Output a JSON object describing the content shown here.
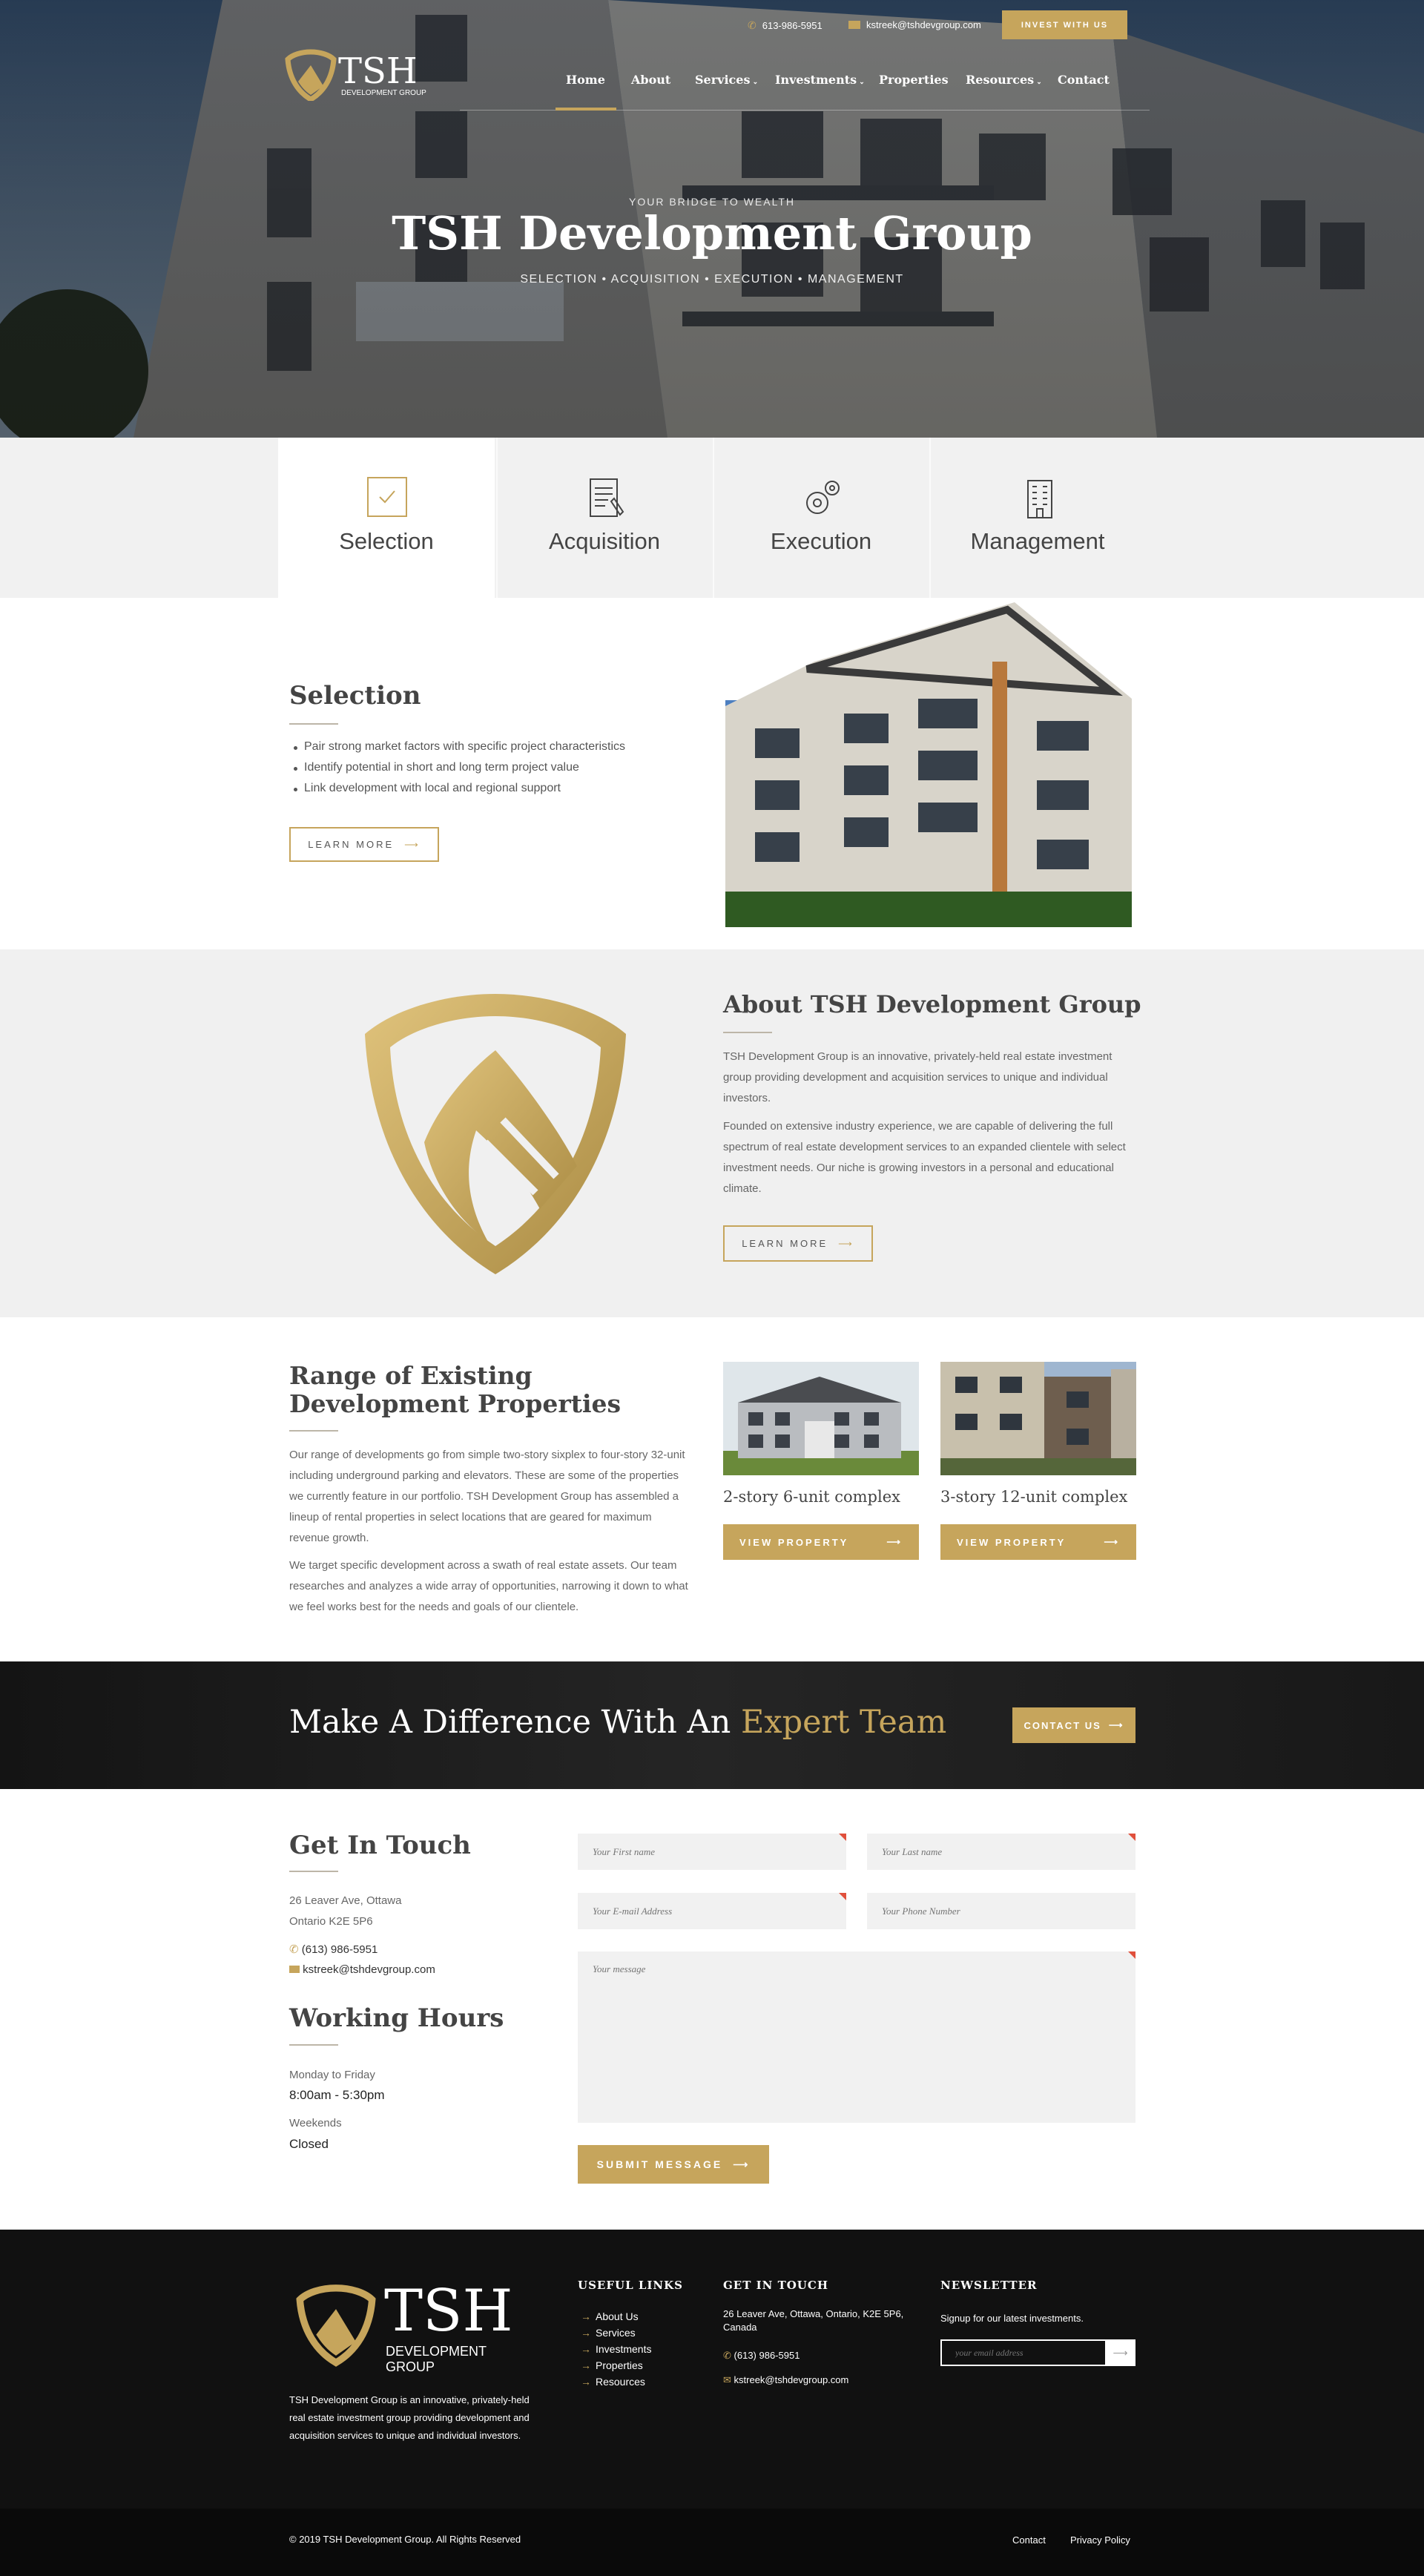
{
  "header": {
    "phone": "613-986-5951",
    "email": "kstreek@tshdevgroup.com",
    "invest_button": "INVEST WITH US",
    "logo_text": "TSH",
    "logo_sub": "DEVELOPMENT GROUP",
    "nav": [
      "Home",
      "About",
      "Services",
      "Investments",
      "Properties",
      "Resources",
      "Contact"
    ]
  },
  "hero": {
    "eyebrow": "YOUR BRIDGE TO WEALTH",
    "title": "TSH Development Group",
    "subtitle": "SELECTION • ACQUISITION • EXECUTION • MANAGEMENT"
  },
  "tabs": [
    "Selection",
    "Acquisition",
    "Execution",
    "Management"
  ],
  "selection": {
    "title": "Selection",
    "bullets": [
      "Pair strong market factors with specific project characteristics",
      "Identify potential in short and long term project value",
      "Link development with local and regional support"
    ],
    "button": "LEARN MORE"
  },
  "about": {
    "title": "About TSH Development Group",
    "p1": "TSH Development Group is an innovative, privately-held real estate investment group providing development and acquisition services to unique and individual investors.",
    "p2": "Founded on extensive industry experience, we are capable of delivering the full spectrum of real estate development services to an expanded clientele with select investment needs. Our niche is growing investors in a personal and educational climate.",
    "button": "LEARN MORE"
  },
  "range": {
    "title": "Range of Existing Development Properties",
    "p1": "Our range of developments go from simple two-story sixplex to four-story 32-unit including underground parking and elevators. These are some of the properties we currently feature in our portfolio. TSH Development Group has assembled a lineup of rental properties in select locations that are geared for maximum revenue growth.",
    "p2": "We target specific development across a swath of real estate assets. Our team researches and analyzes a wide array of opportunities, narrowing it down to what we feel works best for the needs and goals of our clientele.",
    "properties": [
      {
        "name": "2-story 6-unit complex",
        "button": "VIEW PROPERTY"
      },
      {
        "name": "3-story 12-unit complex",
        "button": "VIEW PROPERTY"
      }
    ]
  },
  "banner": {
    "text": "Make A Difference With An ",
    "highlight": "Expert Team",
    "button": "CONTACT US"
  },
  "contact": {
    "title": "Get In Touch",
    "address1": "26 Leaver Ave, Ottawa",
    "address2": "Ontario K2E 5P6",
    "phone": "(613) 986-5951",
    "email": "kstreek@tshdevgroup.com",
    "hours_title": "Working Hours",
    "weekday_label": "Monday to Friday",
    "weekday_hours": "8:00am - 5:30pm",
    "weekend_label": "Weekends",
    "weekend_hours": "Closed",
    "form": {
      "first_name": "Your First name",
      "last_name": "Your Last name",
      "email": "Your E-mail Address",
      "phone": "Your Phone Number",
      "message": "Your message",
      "submit": "SUBMIT MESSAGE"
    }
  },
  "footer": {
    "logo_text": "TSH",
    "logo_sub": "DEVELOPMENT GROUP",
    "about": "TSH Development Group is an innovative, privately-held real estate investment group providing development and acquisition services to unique and individual investors.",
    "useful_links_title": "USEFUL LINKS",
    "useful_links": [
      "About Us",
      "Services",
      "Investments",
      "Properties",
      "Resources"
    ],
    "touch_title": "GET IN TOUCH",
    "touch_address": "26 Leaver Ave, Ottawa, Ontario, K2E 5P6, Canada",
    "touch_phone": "(613) 986-5951",
    "touch_email": "kstreek@tshdevgroup.com",
    "newsletter_title": "NEWSLETTER",
    "newsletter_text": "Signup for our latest investments.",
    "newsletter_placeholder": "your email address",
    "copyright": "© 2019 TSH Development Group. All Rights Reserved",
    "bottom_links": [
      "Contact",
      "Privacy Policy"
    ]
  },
  "colors": {
    "accent": "#c6a55c",
    "dark": "#111111",
    "light_bg": "#f0f0f0"
  }
}
